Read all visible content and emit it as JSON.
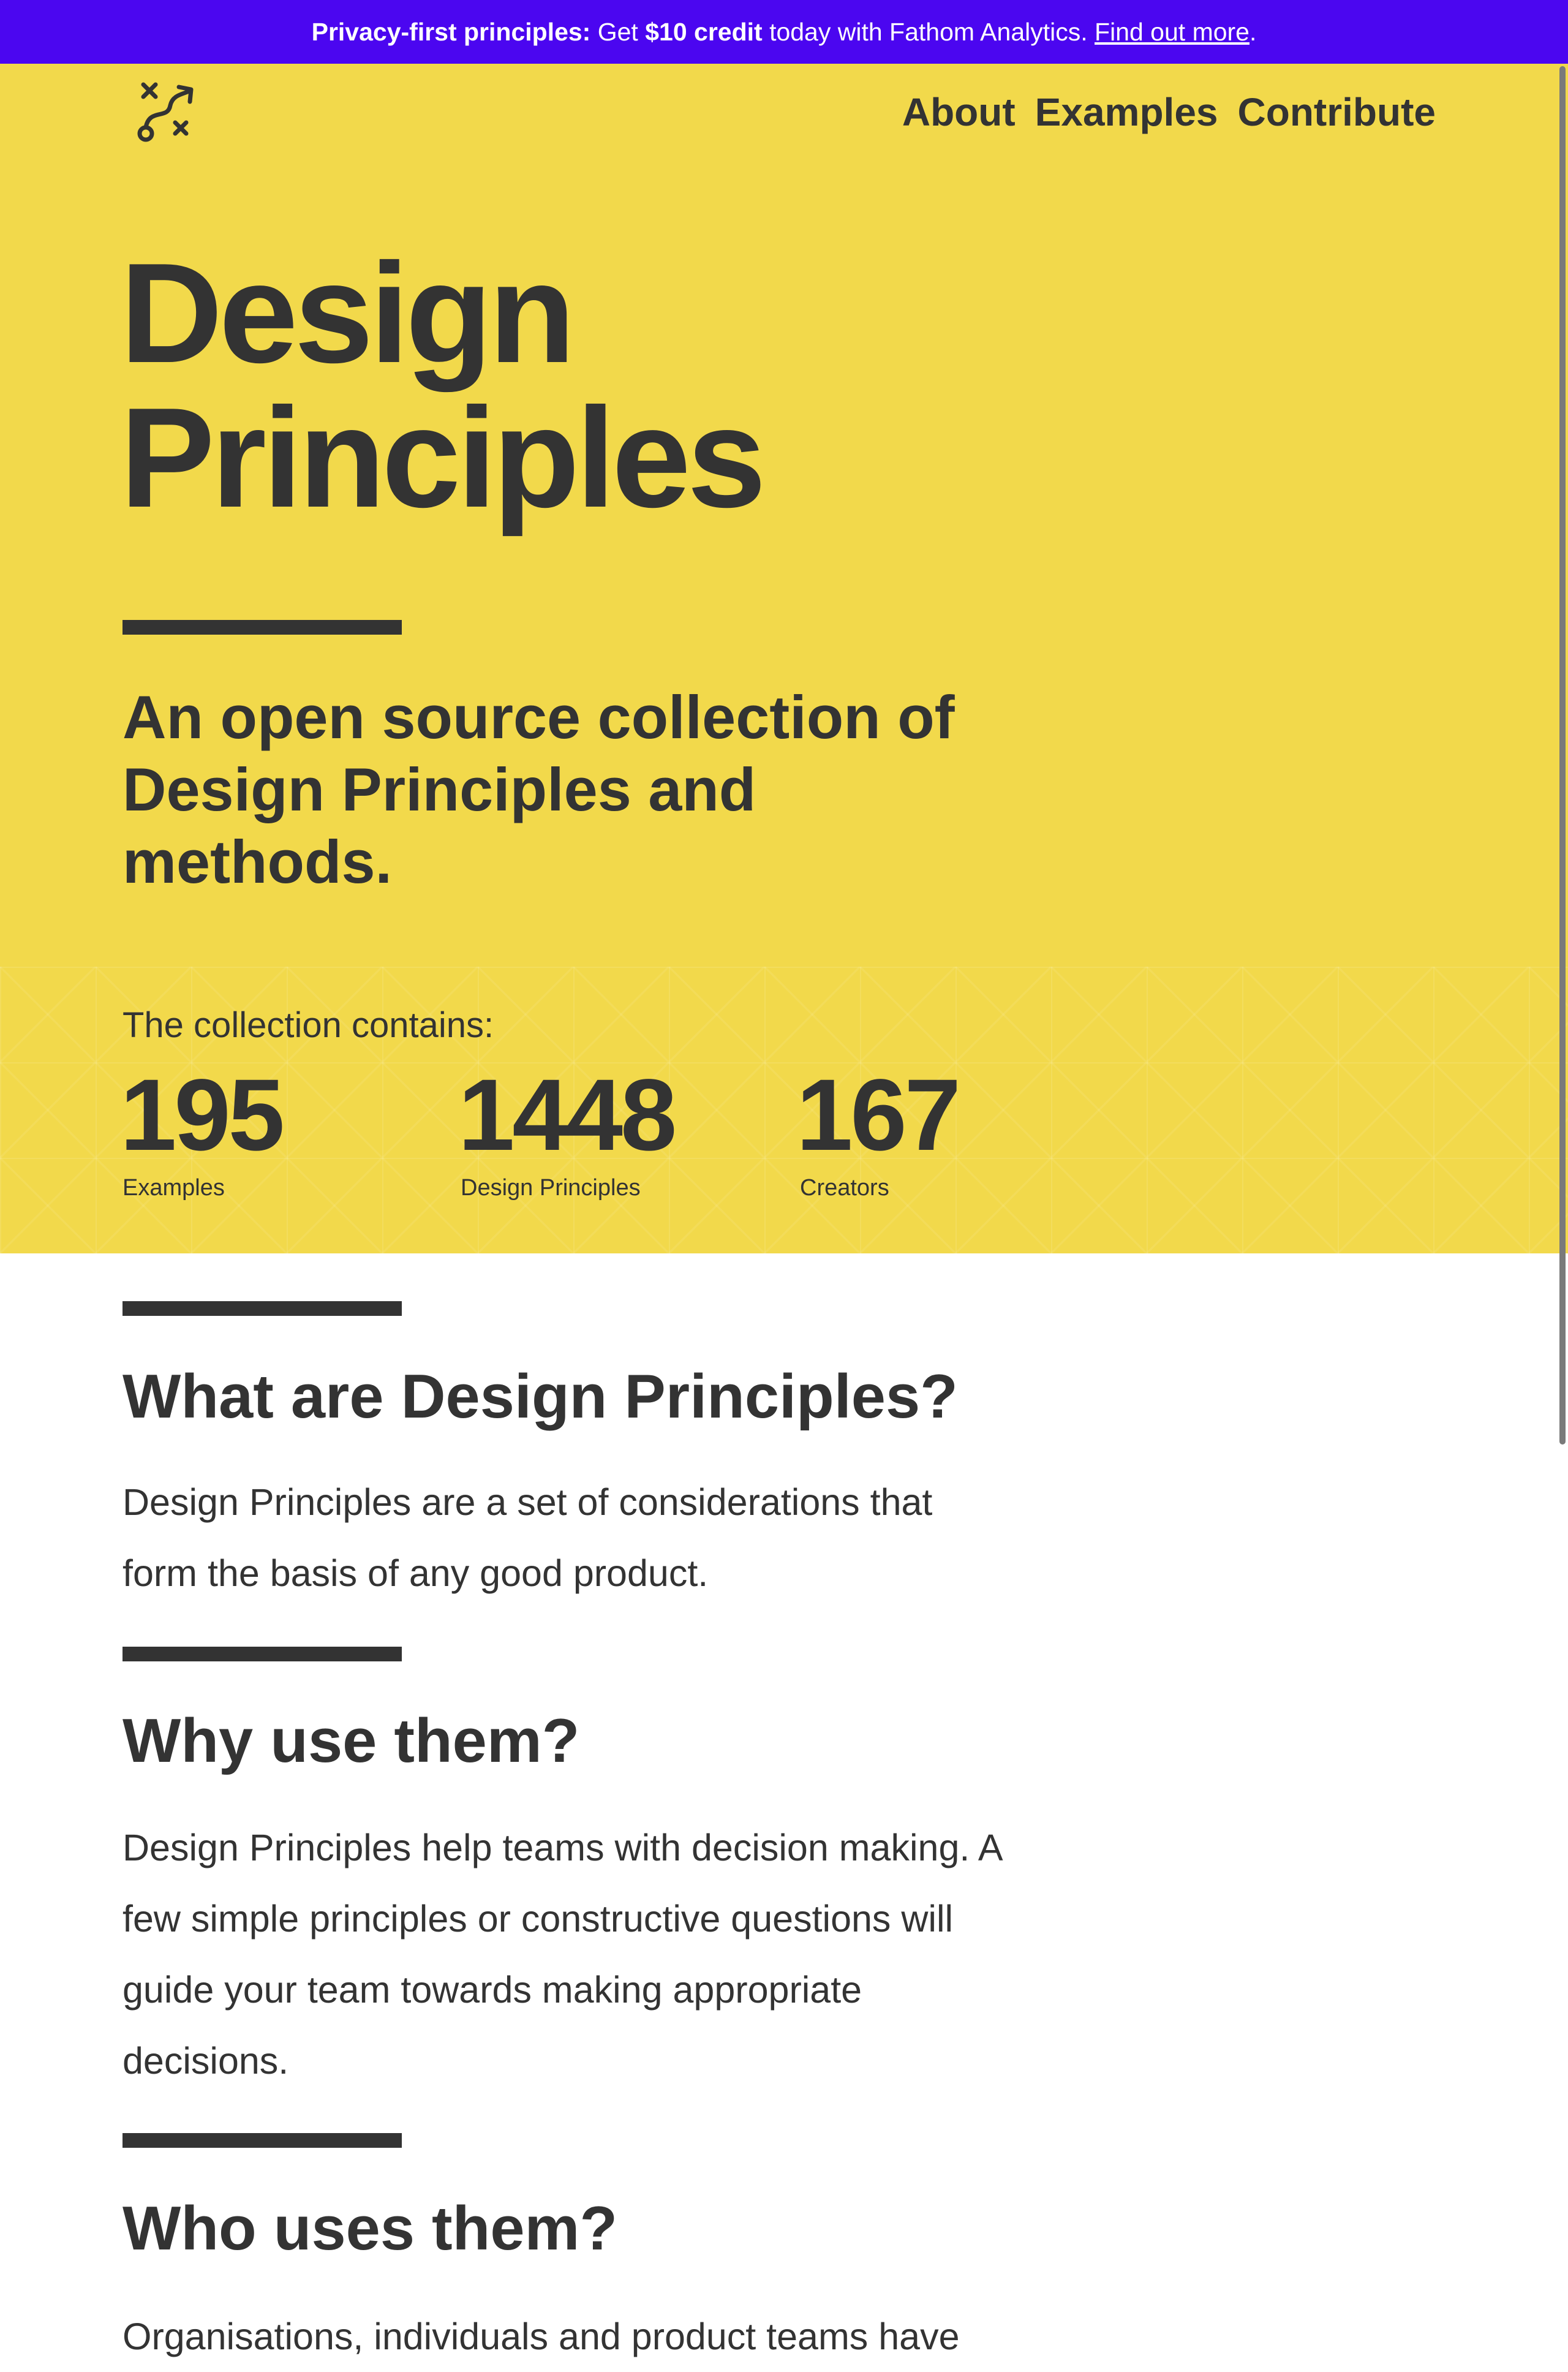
{
  "promo": {
    "bold_lead": "Privacy-first principles:",
    "text_1": " Get ",
    "bold_credit": "$10 credit",
    "text_2": " today with Fathom Analytics. ",
    "link": "Find out more",
    "text_3": "."
  },
  "colors": {
    "promo_bg": "#4b06f0",
    "hero_bg": "#f2d94b",
    "text": "#333333",
    "page_bg": "#ffffff"
  },
  "logo": {
    "icon": "route-path-icon"
  },
  "nav": {
    "items": [
      "About",
      "Examples",
      "Contribute"
    ]
  },
  "hero": {
    "title_line_1": "Design",
    "title_line_2": "Principles",
    "subtitle": "An open source collection of Design Principles and methods."
  },
  "stats": {
    "label": "The collection contains:",
    "items": [
      {
        "value": "195",
        "label": "Examples"
      },
      {
        "value": "1448",
        "label": "Design Principles"
      },
      {
        "value": "167",
        "label": "Creators"
      }
    ]
  },
  "sections": [
    {
      "title": "What are Design Principles?",
      "body": "Design Principles are a set of considerations that form the basis of any good product."
    },
    {
      "title": "Why use them?",
      "body": "Design Principles help teams with decision making. A few simple principles or constructive questions will guide your team towards making appropriate decisions."
    },
    {
      "title": "Who uses them?",
      "body": "Organisations, individuals and product teams have"
    }
  ]
}
